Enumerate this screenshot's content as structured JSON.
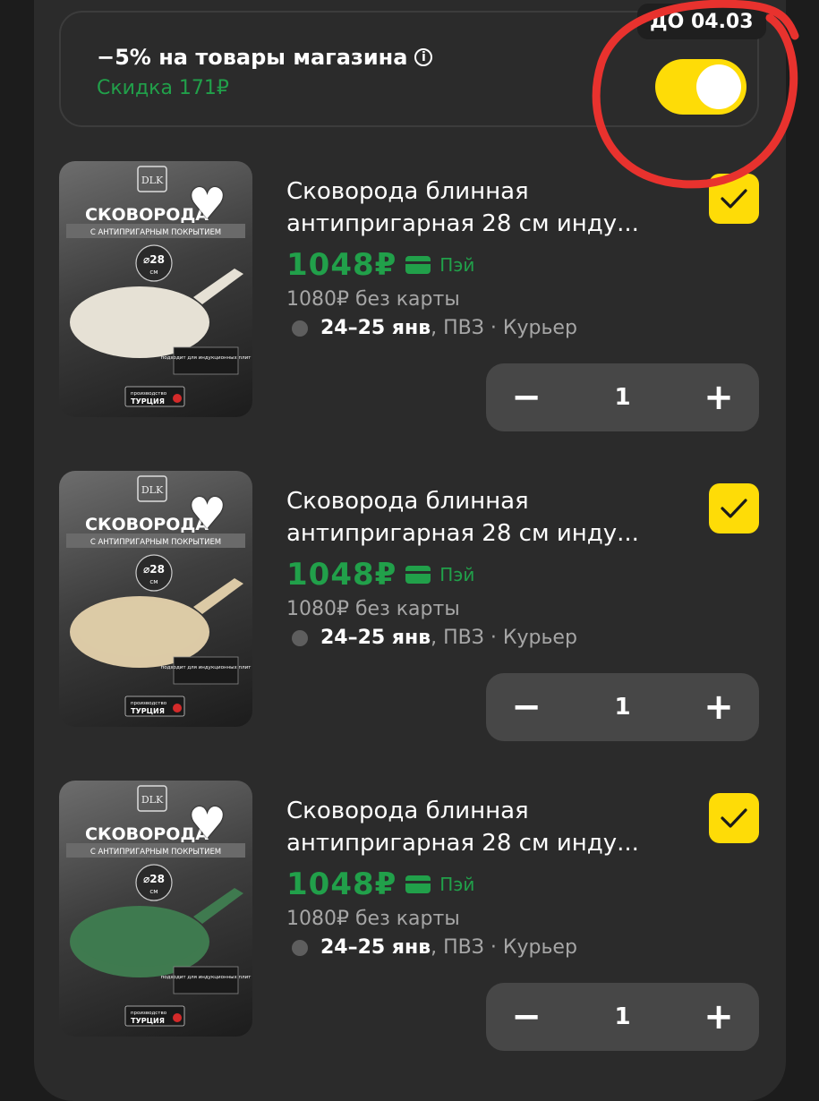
{
  "promo": {
    "title": "−5% на товары магазина",
    "discount": "Скидка 171₽",
    "badge": "ДО 04.03",
    "toggle_on": true,
    "accent": "#fedc07",
    "green": "#21a04a"
  },
  "items": [
    {
      "title": "Сковорода блинная антипригарная 28 см инду...",
      "price": "1048₽",
      "pay": "Пэй",
      "old_price": "1080₽ без карты",
      "delivery_date": "24–25 янв",
      "delivery_rest": ", ПВЗ · Курьер",
      "quantity": "1",
      "checked": true,
      "image": {
        "brand": "DLK",
        "heading": "СКОВОРОДА",
        "subheading": "С АНТИПРИГАРНЫМ ПОКРЫТИЕМ",
        "size": "⌀28",
        "size_unit": "см",
        "note": "подходит для индукционных плит",
        "origin_label": "производство",
        "origin": "ТУРЦИЯ",
        "pan_color": "#e6e1d5"
      }
    },
    {
      "title": "Сковорода блинная антипригарная 28 см инду...",
      "price": "1048₽",
      "pay": "Пэй",
      "old_price": "1080₽ без карты",
      "delivery_date": "24–25 янв",
      "delivery_rest": ", ПВЗ · Курьер",
      "quantity": "1",
      "checked": true,
      "image": {
        "brand": "DLK",
        "heading": "СКОВОРОДА",
        "subheading": "С АНТИПРИГАРНЫМ ПОКРЫТИЕМ",
        "size": "⌀28",
        "size_unit": "см",
        "note": "подходит для индукционных плит",
        "origin_label": "производство",
        "origin": "ТУРЦИЯ",
        "pan_color": "#dccaa6"
      }
    },
    {
      "title": "Сковорода блинная антипригарная 28 см инду...",
      "price": "1048₽",
      "pay": "Пэй",
      "old_price": "1080₽ без карты",
      "delivery_date": "24–25 янв",
      "delivery_rest": ", ПВЗ · Курьер",
      "quantity": "1",
      "checked": true,
      "image": {
        "brand": "DLK",
        "heading": "СКОВОРОДА",
        "subheading": "С АНТИПРИГАРНЫМ ПОКРЫТИЕМ",
        "size": "⌀28",
        "size_unit": "см",
        "note": "подходит для индукционных плит",
        "origin_label": "производство",
        "origin": "ТУРЦИЯ",
        "pan_color": "#3f7a4f"
      }
    }
  ],
  "stepper": {
    "minus": "−",
    "plus": "+"
  },
  "icons": {
    "info": "info-icon",
    "heart": "heart-icon",
    "check": "checkmark-icon",
    "card": "card-icon",
    "dot": "delivery-dot-icon"
  },
  "annotation_color": "#e8322e"
}
